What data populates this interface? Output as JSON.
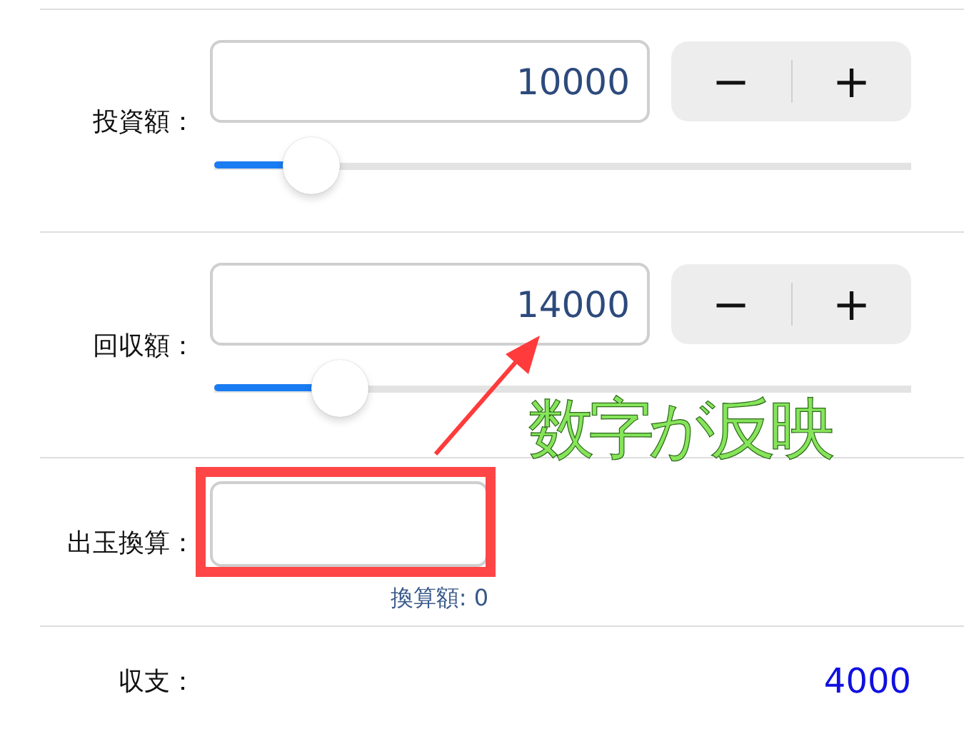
{
  "rows": [
    {
      "kind": "amount",
      "label": "投資額：",
      "value": "10000",
      "stepper": {
        "minus": "−",
        "plus": "+"
      },
      "slider": {
        "level": 0.14
      }
    },
    {
      "kind": "amount",
      "label": "回収額：",
      "value": "14000",
      "stepper": {
        "minus": "−",
        "plus": "+"
      },
      "slider": {
        "level": 0.18
      }
    },
    {
      "kind": "convert",
      "label": "出玉換算：",
      "caption": "換算額: 0",
      "highlighted": true
    },
    {
      "kind": "result",
      "label": "収支：",
      "value": "4000"
    }
  ],
  "annotation": {
    "text": "数字が反映"
  }
}
